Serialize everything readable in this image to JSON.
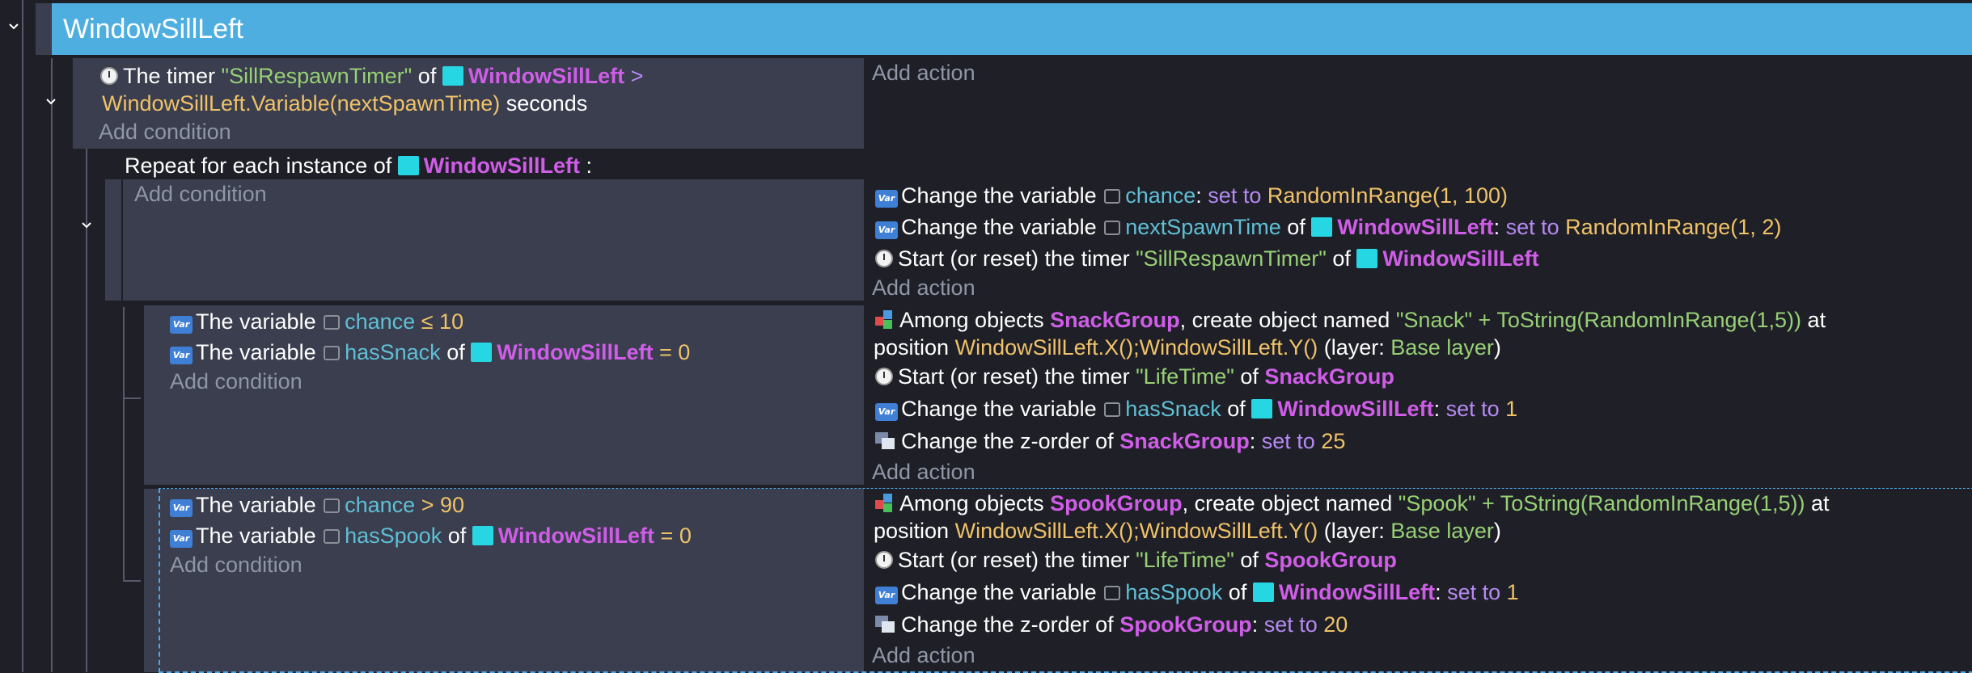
{
  "group": {
    "title": "WindowSillLeft"
  },
  "event1": {
    "condition": {
      "prefix": "The timer",
      "timer_name": "\"SillRespawnTimer\"",
      "of": "of",
      "object": "WindowSillLeft",
      "gt": ">",
      "expression": "WindowSillLeft.Variable(nextSpawnTime)",
      "suffix": "seconds"
    },
    "add_condition": "Add condition",
    "add_action": "Add action"
  },
  "repeat": {
    "prefix": "Repeat for each instance of",
    "object": "WindowSillLeft",
    "suffix": ":",
    "add_condition": "Add condition",
    "actions": {
      "a1": {
        "prefix": "Change the variable",
        "var": "chance",
        "colon": ":",
        "op": "set to",
        "value": "RandomInRange(1, 100)"
      },
      "a2": {
        "prefix": "Change the variable",
        "var": "nextSpawnTime",
        "of": "of",
        "object": "WindowSillLeft",
        "colon": ":",
        "op": "set to",
        "value": "RandomInRange(1, 2)"
      },
      "a3": {
        "prefix": "Start (or reset) the timer",
        "timer": "\"SillRespawnTimer\"",
        "of": "of",
        "object": "WindowSillLeft"
      }
    },
    "add_action": "Add action"
  },
  "snack": {
    "cond1": {
      "prefix": "The variable",
      "var": "chance",
      "op": "≤",
      "value": "10"
    },
    "cond2": {
      "prefix": "The variable",
      "var": "hasSnack",
      "of": "of",
      "object": "WindowSillLeft",
      "op": "=",
      "value": "0"
    },
    "add_condition": "Add condition",
    "create": {
      "prefix": "Among objects",
      "group": "SnackGroup",
      "mid": ", create object named",
      "name": "\"Snack\" + ToString(RandomInRange(1,5))",
      "at": "at",
      "position_label": "position",
      "position": "WindowSillLeft.X();WindowSillLeft.Y()",
      "layer_open": "(layer:",
      "layer": "Base layer",
      "layer_close": ")"
    },
    "timer": {
      "prefix": "Start (or reset) the timer",
      "timer": "\"LifeTime\"",
      "of": "of",
      "group": "SnackGroup"
    },
    "setvar": {
      "prefix": "Change the variable",
      "var": "hasSnack",
      "of": "of",
      "object": "WindowSillLeft",
      "colon": ":",
      "op": "set to",
      "value": "1"
    },
    "zorder": {
      "prefix": "Change the z-order of",
      "group": "SnackGroup",
      "colon": ":",
      "op": "set to",
      "value": "25"
    },
    "add_action": "Add action"
  },
  "spook": {
    "cond1": {
      "prefix": "The variable",
      "var": "chance",
      "op": ">",
      "value": "90"
    },
    "cond2": {
      "prefix": "The variable",
      "var": "hasSpook",
      "of": "of",
      "object": "WindowSillLeft",
      "op": "=",
      "value": "0"
    },
    "add_condition": "Add condition",
    "create": {
      "prefix": "Among objects",
      "group": "SpookGroup",
      "mid": ", create object named",
      "name": "\"Spook\" + ToString(RandomInRange(1,5))",
      "at": "at",
      "position_label": "position",
      "position": "WindowSillLeft.X();WindowSillLeft.Y()",
      "layer_open": "(layer:",
      "layer": "Base layer",
      "layer_close": ")"
    },
    "timer": {
      "prefix": "Start (or reset) the timer",
      "timer": "\"LifeTime\"",
      "of": "of",
      "group": "SpookGroup"
    },
    "setvar": {
      "prefix": "Change the variable",
      "var": "hasSpook",
      "of": "of",
      "object": "WindowSillLeft",
      "colon": ":",
      "op": "set to",
      "value": "1"
    },
    "zorder": {
      "prefix": "Change the z-order of",
      "group": "SpookGroup",
      "colon": ":",
      "op": "set to",
      "value": "20"
    },
    "add_action": "Add action"
  },
  "icons": {
    "var_icon_text": "Var",
    "collapse": "chevron-down-icon"
  }
}
